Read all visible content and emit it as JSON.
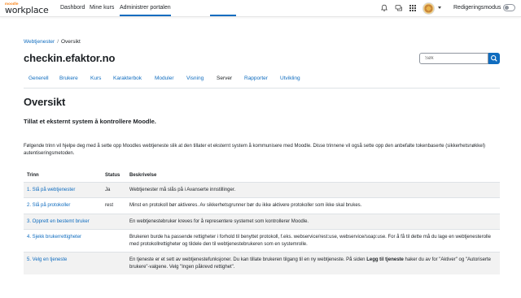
{
  "navbar": {
    "logo_small": "moodle",
    "logo_big": "workplace",
    "links": [
      "Dashbord",
      "Mine kurs",
      "Administrer portalen"
    ],
    "active_link": "Administrer portalen",
    "icons": [
      "bell-icon",
      "chat-icon",
      "grid-icon"
    ],
    "edit_mode_label": "Redigeringsmodus"
  },
  "breadcrumb": {
    "parent": "Webtjenester",
    "current": "Oversikt"
  },
  "page_title": "checkin.efaktor.no",
  "search": {
    "placeholder": "Søk"
  },
  "tabs": [
    "Generell",
    "Brukere",
    "Kurs",
    "Karakterbok",
    "Moduler",
    "Visning",
    "Server",
    "Rapporter",
    "Utvikling"
  ],
  "active_tab": "Server",
  "content": {
    "heading": "Oversikt",
    "subheading": "Tillat et eksternt system å kontrollere Moodle.",
    "intro": "Følgende trinn vil hjelpe deg med å sette opp Moodles webtjeneste slik at den tillater et eksternt system å kommunisere med Moodle. Disse trinnene vil også sette opp den anbefalte tokenbaserte (sikkerhetsnøkkel) autentiseringsmetoden."
  },
  "table": {
    "headers": [
      "Trinn",
      "Status",
      "Beskrivelse"
    ],
    "rows": [
      {
        "step": "1. Slå på webtjenester",
        "status": "Ja",
        "description": "Webtjenester må slås på i Avanserte innstillinger."
      },
      {
        "step": "2. Slå på protokoller",
        "status": "rest",
        "description": "Minst en protokoll bør aktiveres. Av sikkerhetsgrunner bør du ikke aktivere protokoller som ikke skal brukes."
      },
      {
        "step": "3. Opprett en bestemt bruker",
        "status": "",
        "description": "En webtjenestebruker kreves for å representere systemet som kontrollerer Moodle."
      },
      {
        "step": "4. Sjekk brukerrettigheter",
        "status": "",
        "description": "Brukeren burde ha passende rettigheter i forhold til benyttet protokoll, f.eks. webservice/rest:use, webservice/soap:use. For å få til dette må du lage en webtjenesterolle med protokollrettigheter og tildele den til webtjenestebrukeren som en systemrolle."
      },
      {
        "step": "5. Velg en tjeneste",
        "status": "",
        "description_pre": "En tjeneste er et sett av webtjenestefunksjoner. Du kan tillate brukeren tilgang til en ny webtjeneste. På siden ",
        "description_bold": "Legg til tjeneste",
        "description_post": " haker du av for \"Aktiver\" og \"Autoriserte brukere\"-valgene. Velg \"Ingen påkrevd rettighet\"."
      }
    ]
  },
  "colors": {
    "accent": "#0f6cbf",
    "brand_orange": "#f98012",
    "stripe": "#f2f2f2"
  }
}
